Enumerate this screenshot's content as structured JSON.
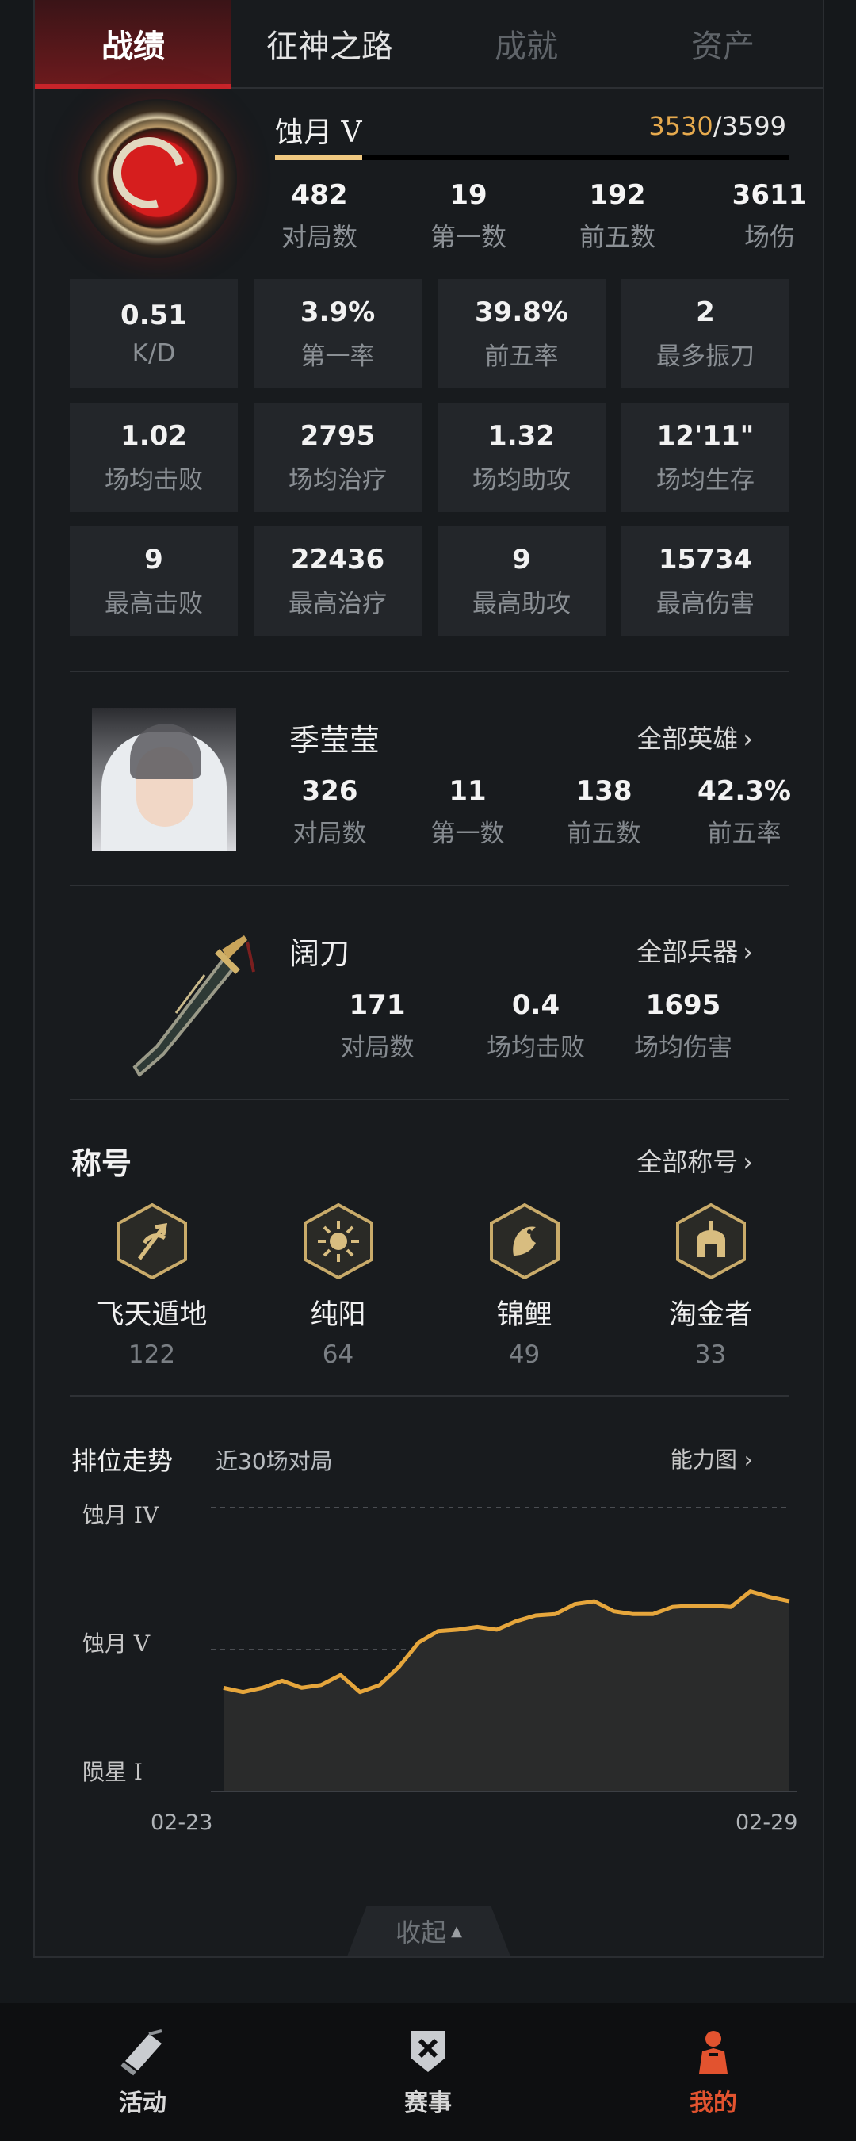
{
  "tabs": [
    "战绩",
    "征神之路",
    "成就",
    "资产"
  ],
  "rank": {
    "name": "蚀月 V",
    "current": "3530",
    "max": "/3599",
    "progress": 0.17
  },
  "top_stats": [
    {
      "value": "482",
      "label": "对局数"
    },
    {
      "value": "19",
      "label": "第一数"
    },
    {
      "value": "192",
      "label": "前五数"
    },
    {
      "value": "3611",
      "label": "场伤"
    }
  ],
  "grid": [
    {
      "value": "0.51",
      "label": "K/D"
    },
    {
      "value": "3.9%",
      "label": "第一率"
    },
    {
      "value": "39.8%",
      "label": "前五率"
    },
    {
      "value": "2",
      "label": "最多振刀"
    },
    {
      "value": "1.02",
      "label": "场均击败"
    },
    {
      "value": "2795",
      "label": "场均治疗"
    },
    {
      "value": "1.32",
      "label": "场均助攻"
    },
    {
      "value": "12'11\"",
      "label": "场均生存"
    },
    {
      "value": "9",
      "label": "最高击败"
    },
    {
      "value": "22436",
      "label": "最高治疗"
    },
    {
      "value": "9",
      "label": "最高助攻"
    },
    {
      "value": "15734",
      "label": "最高伤害"
    }
  ],
  "hero": {
    "name": "季莹莹",
    "link": "全部英雄",
    "stats": [
      {
        "value": "326",
        "label": "对局数"
      },
      {
        "value": "11",
        "label": "第一数"
      },
      {
        "value": "138",
        "label": "前五数"
      },
      {
        "value": "42.3%",
        "label": "前五率"
      }
    ]
  },
  "weapon": {
    "name": "阔刀",
    "link": "全部兵器",
    "stats": [
      {
        "value": "171",
        "label": "对局数"
      },
      {
        "value": "0.4",
        "label": "场均击败"
      },
      {
        "value": "1695",
        "label": "场均伤害"
      }
    ]
  },
  "titles": {
    "heading": "称号",
    "link": "全部称号",
    "items": [
      {
        "name": "飞天遁地",
        "count": "122",
        "icon": "trident-icon"
      },
      {
        "name": "纯阳",
        "count": "64",
        "icon": "sun-icon"
      },
      {
        "name": "锦鲤",
        "count": "49",
        "icon": "koi-icon"
      },
      {
        "name": "淘金者",
        "count": "33",
        "icon": "helmet-icon"
      }
    ]
  },
  "trend": {
    "heading": "排位走势",
    "subtitle": "近30场对局",
    "link": "能力图",
    "collapse": "收起"
  },
  "chart_data": {
    "type": "area",
    "y_tick_labels": [
      "蚀月 IV",
      "蚀月 V",
      "陨星 I"
    ],
    "x_tick_labels": [
      "02-23",
      "02-29"
    ],
    "xlabel": "",
    "ylabel": "",
    "ylim": [
      0,
      2
    ],
    "grid": "dashed at 蚀月 IV and 蚀月 V",
    "color": "#e6a63c",
    "values": [
      0.73,
      0.7,
      0.73,
      0.78,
      0.73,
      0.75,
      0.82,
      0.7,
      0.75,
      0.88,
      1.05,
      1.13,
      1.14,
      1.16,
      1.14,
      1.2,
      1.24,
      1.25,
      1.32,
      1.34,
      1.27,
      1.25,
      1.25,
      1.3,
      1.31,
      1.31,
      1.3,
      1.41,
      1.37,
      1.34
    ]
  },
  "nav": [
    {
      "label": "活动",
      "icon": "scroll-icon"
    },
    {
      "label": "赛事",
      "icon": "shield-icon"
    },
    {
      "label": "我的",
      "icon": "warrior-icon"
    }
  ],
  "colors": {
    "accent_red": "#c8242a",
    "gold": "#e6aa4e",
    "active_nav": "#e2532f"
  }
}
